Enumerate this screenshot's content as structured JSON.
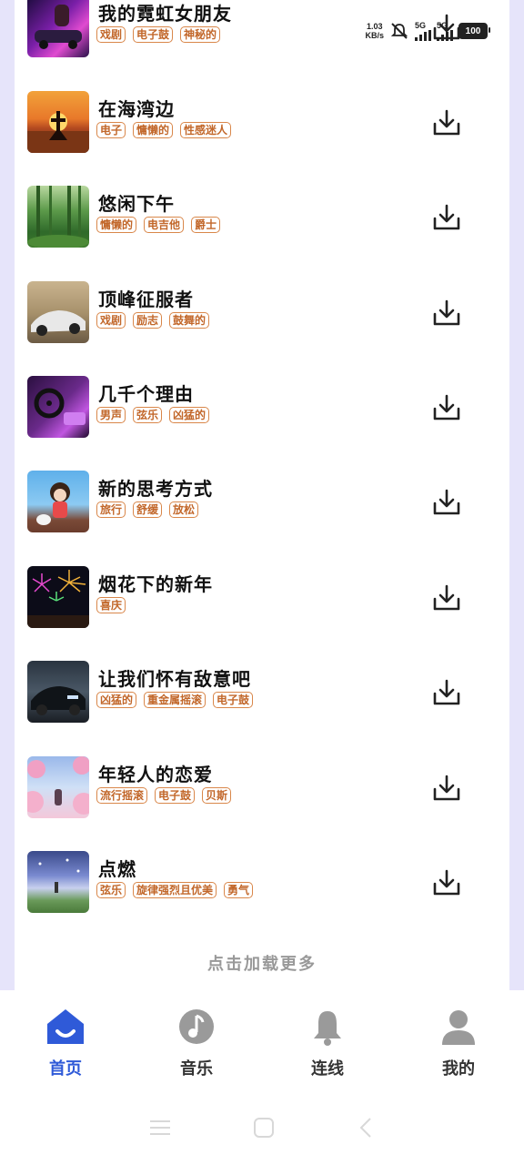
{
  "status_bar": {
    "speed_value": "1.03",
    "speed_unit": "KB/s",
    "net1": "5G",
    "net2": "5G",
    "battery": "100"
  },
  "songs": [
    {
      "title": "我的霓虹女朋友",
      "tags": [
        "戏剧",
        "电子鼓",
        "神秘的"
      ]
    },
    {
      "title": "在海湾边",
      "tags": [
        "电子",
        "慵懒的",
        "性感迷人"
      ]
    },
    {
      "title": "悠闲下午",
      "tags": [
        "慵懒的",
        "电吉他",
        "爵士"
      ]
    },
    {
      "title": "顶峰征服者",
      "tags": [
        "戏剧",
        "励志",
        "鼓舞的"
      ]
    },
    {
      "title": "几千个理由",
      "tags": [
        "男声",
        "弦乐",
        "凶猛的"
      ]
    },
    {
      "title": "新的思考方式",
      "tags": [
        "旅行",
        "舒缓",
        "放松"
      ]
    },
    {
      "title": "烟花下的新年",
      "tags": [
        "喜庆"
      ]
    },
    {
      "title": "让我们怀有敌意吧",
      "tags": [
        "凶猛的",
        "重金属摇滚",
        "电子鼓"
      ]
    },
    {
      "title": "年轻人的恋爱",
      "tags": [
        "流行摇滚",
        "电子鼓",
        "贝斯"
      ]
    },
    {
      "title": "点燃",
      "tags": [
        "弦乐",
        "旋律强烈且优美",
        "勇气"
      ]
    }
  ],
  "load_more": "点击加载更多",
  "tabs": [
    {
      "label": "首页",
      "icon": "home-icon",
      "active": true
    },
    {
      "label": "音乐",
      "icon": "music-note-icon",
      "active": false
    },
    {
      "label": "连线",
      "icon": "bell-icon",
      "active": false
    },
    {
      "label": "我的",
      "icon": "person-icon",
      "active": false
    }
  ],
  "colors": {
    "accent": "#2f5ad8",
    "tag_border": "#d9874a",
    "background": "#e6e4fa"
  }
}
